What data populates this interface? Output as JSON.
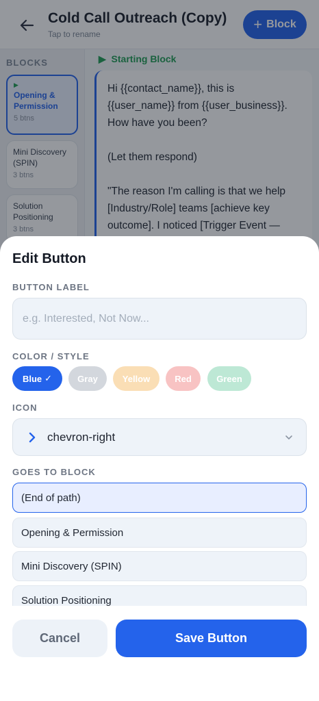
{
  "header": {
    "title": "Cold Call Outreach (Copy)",
    "subtitle": "Tap to rename",
    "add_block_label": "Block"
  },
  "sidebar": {
    "heading": "BLOCKS",
    "blocks": [
      {
        "name": "Opening & Permission",
        "count": "5 btns",
        "is_start": true
      },
      {
        "name": "Mini Discovery (SPIN)",
        "count": "3 btns"
      },
      {
        "name": "Solution Positioning",
        "count": "3 btns"
      }
    ]
  },
  "editor": {
    "starting_label": "Starting Block",
    "script_paragraphs": [
      "Hi {{contact_name}}, this is {{user_name}} from {{user_business}}. How have you been?",
      "(Let them respond)",
      "\"The reason I'm calling is that we help [Industry/Role] teams [achieve key outcome]. I noticed [Trigger Event —"
    ]
  },
  "sheet": {
    "title": "Edit Button",
    "button_label": {
      "label": "BUTTON LABEL",
      "placeholder": "e.g. Interested, Not Now...",
      "value": ""
    },
    "color_style": {
      "label": "COLOR / STYLE",
      "options": [
        "Blue",
        "Gray",
        "Yellow",
        "Red",
        "Green"
      ],
      "selected": "Blue",
      "colors": {
        "blue": "#2463eb",
        "gray": "#d3d7dd",
        "yellow": "#fadeb5",
        "red": "#f8c3c3",
        "green": "#bde8d5"
      }
    },
    "icon": {
      "label": "ICON",
      "selected_icon": "chevron-right",
      "value": "chevron-right"
    },
    "goes_to": {
      "label": "GOES TO BLOCK",
      "options": [
        "(End of path)",
        "Opening & Permission",
        "Mini Discovery (SPIN)",
        "Solution Positioning"
      ],
      "selected": "(End of path)"
    },
    "actions": {
      "cancel_label": "Cancel",
      "save_label": "Save Button"
    }
  },
  "accent_color": "#2463eb",
  "start_color": "#1f9d55"
}
